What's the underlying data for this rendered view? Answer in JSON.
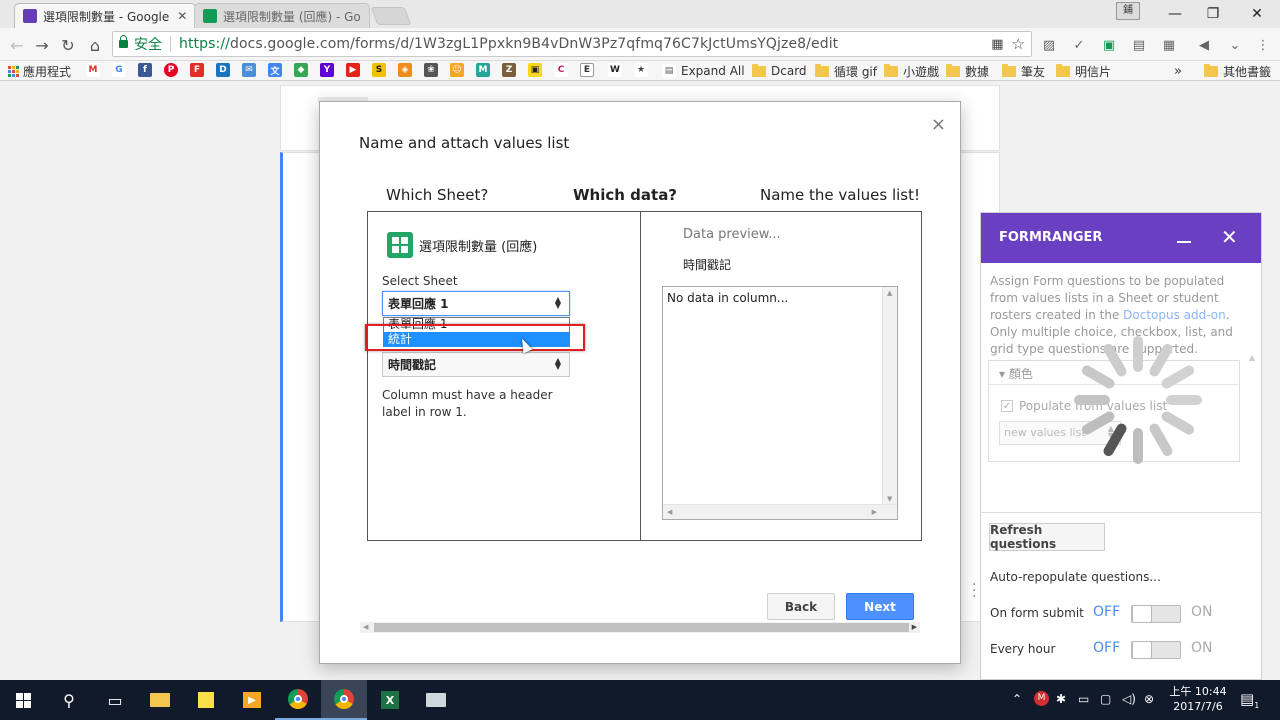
{
  "browser": {
    "tabs": [
      {
        "title": "選項限制數量 - Google",
        "favicon_color": "#673ab7",
        "active": true
      },
      {
        "title": "選項限制數量 (回應) - Go",
        "favicon_color": "#0f9d58",
        "active": false
      }
    ],
    "profile_label": "鋪",
    "window_controls": {
      "minimize": "—",
      "restore": "❐",
      "close": "✕"
    },
    "toolbar": {
      "back_icon": "←",
      "forward_icon": "→",
      "reload_icon": "↻",
      "home_icon": "⌂",
      "secure_label": "安全",
      "url_protocol": "https://",
      "url_rest": "docs.google.com/forms/d/1W3zgL1Ppxkn9B4vDnW3Pz7qfmq76C7kJctUmsYQjze8/edit"
    },
    "bookmarks": {
      "apps_label": "應用程式",
      "expand_all": "Expand All",
      "folders": [
        "Dcard",
        "循環 gif",
        "小遊戲",
        "數據",
        "筆友",
        "明信片"
      ],
      "more": "»",
      "other": "其他書籤"
    }
  },
  "modal": {
    "title": "Name and attach values list",
    "close": "×",
    "steps": [
      "Which Sheet?",
      "Which data?",
      "Name the values list!"
    ],
    "spreadsheet_name": "選項限制數量 (回應)",
    "select_sheet_label": "Select Sheet",
    "selected_sheet": "表單回應 1",
    "sheet_options": [
      "表單回應 1",
      "統計"
    ],
    "highlighted_option": "統計",
    "column_value": "時間戳記",
    "column_note": "Column must have a header label in row 1.",
    "data_preview_title": "Data preview...",
    "preview_column": "時間戳記",
    "preview_empty": "No data in column...",
    "back_label": "Back",
    "next_label": "Next"
  },
  "sidebar": {
    "title": "FORMRANGER",
    "minimize": "",
    "close": "✕",
    "description_1": "Assign Form questions to be populated from values lists in a Sheet or student rosters created in the ",
    "description_link": "Doctopus add-on",
    "description_2": ". Only multiple choice, checkbox, list, and grid type questions are supported.",
    "question_name": "顏色",
    "populate_label": "Populate from values list",
    "values_select": "new values list",
    "refresh_label": "Refresh questions",
    "auto_repopulate": "Auto-repopulate questions...",
    "on_form_submit_label": "On form submit",
    "every_hour_label": "Every hour",
    "off_label": "OFF",
    "on_label": "ON"
  },
  "taskbar": {
    "time": "上午 10:44",
    "date": "2017/7/6",
    "notification_count": "1"
  }
}
